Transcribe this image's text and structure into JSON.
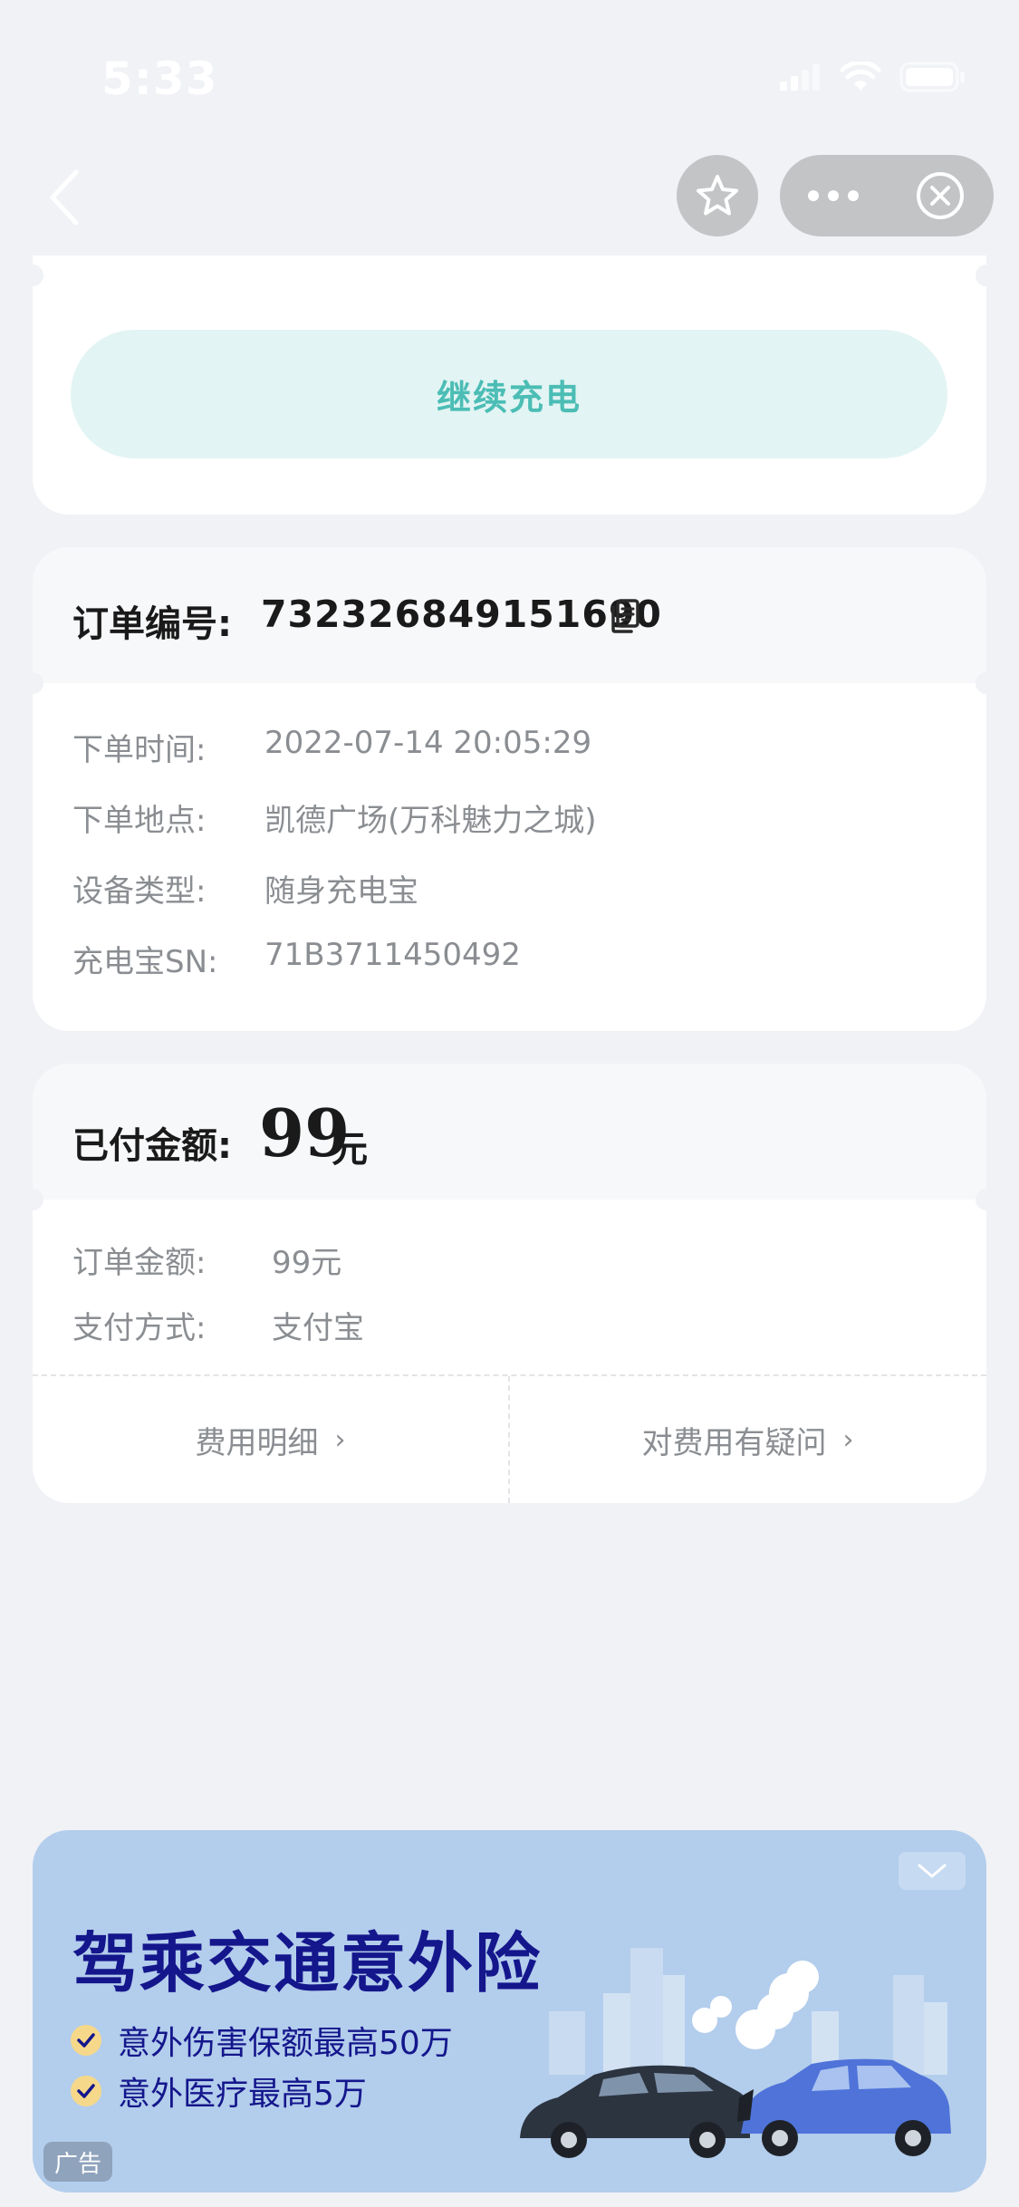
{
  "status_bar": {
    "time": "5:33"
  },
  "actions": {
    "continue_label": "继续充电"
  },
  "order": {
    "number_label": "订单编号:",
    "number_value": "732326849151690",
    "details": [
      {
        "label": "下单时间:",
        "value": "2022-07-14 20:05:29"
      },
      {
        "label": "下单地点:",
        "value": "凯德广场(万科魅力之城)"
      },
      {
        "label": "设备类型:",
        "value": "随身充电宝"
      },
      {
        "label": "充电宝SN:",
        "value": "71B3711450492"
      }
    ]
  },
  "payment": {
    "paid_label": "已付金额:",
    "paid_amount": "99",
    "paid_unit": "元",
    "rows": [
      {
        "label": "订单金额:",
        "value": "99元"
      },
      {
        "label": "支付方式:",
        "value": "支付宝"
      }
    ],
    "links": [
      {
        "label": "费用明细",
        "chevron": "›"
      },
      {
        "label": "对费用有疑问",
        "chevron": "›"
      }
    ]
  },
  "ad": {
    "title": "驾乘交通意外险",
    "points": [
      "意外伤害保额最高50万",
      "意外医疗最高5万"
    ],
    "tag": "广告"
  },
  "colors": {
    "background": "#f0f2f5",
    "accent": "#4bbdb5",
    "ad_background": "#b3cdec",
    "ad_title": "#14168c"
  }
}
